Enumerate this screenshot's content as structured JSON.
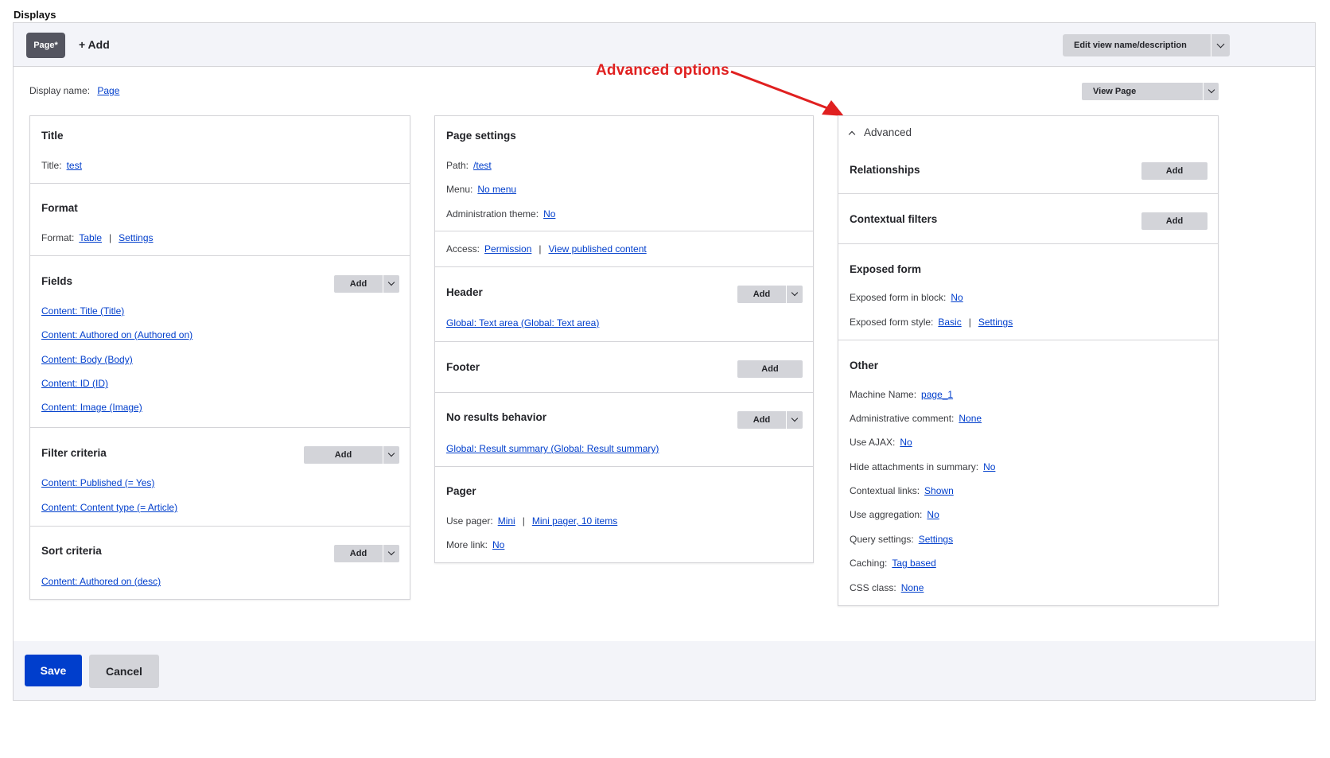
{
  "displays": {
    "label": "Displays",
    "tabs": [
      {
        "label": "Page*"
      }
    ],
    "add_label": "+ Add",
    "edit_view_label": "Edit view name/description"
  },
  "display_name": {
    "label": "Display name:",
    "value": "Page"
  },
  "view_page_label": "View Page",
  "annotation": {
    "text": "Advanced options",
    "color": "#e02020"
  },
  "left_column": {
    "title": {
      "heading": "Title",
      "label": "Title:",
      "value": "test"
    },
    "format": {
      "heading": "Format",
      "label": "Format:",
      "value": "Table",
      "settings": "Settings"
    },
    "fields": {
      "heading": "Fields",
      "add_label": "Add",
      "items": [
        "Content: Title (Title)",
        "Content: Authored on (Authored on)",
        "Content: Body (Body)",
        "Content: ID (ID)",
        "Content: Image (Image)"
      ]
    },
    "filter_criteria": {
      "heading": "Filter criteria",
      "add_label": "Add",
      "items": [
        "Content: Published (= Yes)",
        "Content: Content type (= Article)"
      ]
    },
    "sort_criteria": {
      "heading": "Sort criteria",
      "add_label": "Add",
      "items": [
        "Content: Authored on (desc)"
      ]
    }
  },
  "middle_column": {
    "page_settings": {
      "heading": "Page settings",
      "path_label": "Path:",
      "path_value": "/test",
      "menu_label": "Menu:",
      "menu_value": "No menu",
      "admin_theme_label": "Administration theme:",
      "admin_theme_value": "No"
    },
    "access": {
      "label": "Access:",
      "value": "Permission",
      "value2": "View published content"
    },
    "header": {
      "heading": "Header",
      "add_label": "Add",
      "items": [
        "Global: Text area (Global: Text area)"
      ]
    },
    "footer": {
      "heading": "Footer",
      "add_label": "Add"
    },
    "no_results": {
      "heading": "No results behavior",
      "add_label": "Add",
      "items": [
        "Global: Result summary (Global: Result summary)"
      ]
    },
    "pager": {
      "heading": "Pager",
      "use_pager_label": "Use pager:",
      "use_pager_value": "Mini",
      "use_pager_value2": "Mini pager, 10 items",
      "more_link_label": "More link:",
      "more_link_value": "No"
    }
  },
  "right_column": {
    "advanced_label": "Advanced",
    "relationships": {
      "heading": "Relationships",
      "add_label": "Add"
    },
    "contextual_filters": {
      "heading": "Contextual filters",
      "add_label": "Add"
    },
    "exposed_form": {
      "heading": "Exposed form",
      "in_block_label": "Exposed form in block:",
      "in_block_value": "No",
      "style_label": "Exposed form style:",
      "style_value": "Basic",
      "style_settings": "Settings"
    },
    "other": {
      "heading": "Other",
      "rows": [
        {
          "label": "Machine Name:",
          "value": "page_1"
        },
        {
          "label": "Administrative comment:",
          "value": "None"
        },
        {
          "label": "Use AJAX:",
          "value": "No"
        },
        {
          "label": "Hide attachments in summary:",
          "value": "No"
        },
        {
          "label": "Contextual links:",
          "value": "Shown"
        },
        {
          "label": "Use aggregation:",
          "value": "No"
        },
        {
          "label": "Query settings:",
          "value": "Settings"
        },
        {
          "label": "Caching:",
          "value": "Tag based"
        },
        {
          "label": "CSS class:",
          "value": "None"
        }
      ]
    }
  },
  "actions": {
    "save_label": "Save",
    "cancel_label": "Cancel"
  }
}
